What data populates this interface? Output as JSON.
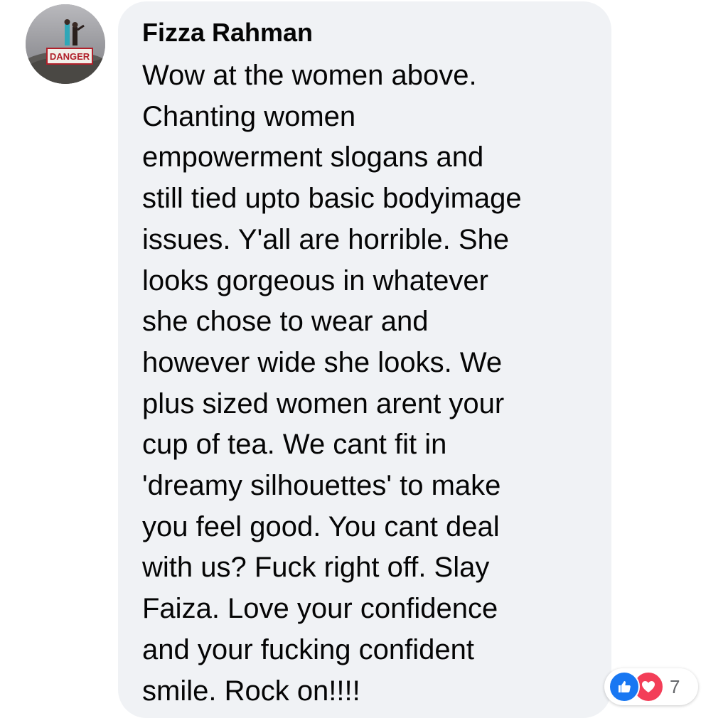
{
  "comment": {
    "author": "Fizza Rahman",
    "avatar_sign_text": "DANGER",
    "lines": [
      "Wow at the women above.",
      "Chanting women",
      "empowerment slogans and",
      "still tied upto basic bodyimage",
      "issues. Y'all are horrible. She",
      "looks gorgeous in whatever",
      "she chose to wear and",
      "however wide she looks. We",
      "plus sized women arent your",
      "cup of tea. We cant fit in",
      "'dreamy silhouettes' to make",
      "you feel good. You cant deal",
      "with us? Fuck right off. Slay",
      "Faiza. Love your confidence",
      "and your fucking confident",
      "smile. Rock on!!!!"
    ]
  },
  "reactions": {
    "icons": [
      "like-icon",
      "love-icon"
    ],
    "count": "7"
  },
  "colors": {
    "bubble_bg": "#f0f2f5",
    "text": "#050505",
    "like_blue": "#1877f2",
    "love_red": "#f33e58",
    "count_gray": "#65676b"
  }
}
